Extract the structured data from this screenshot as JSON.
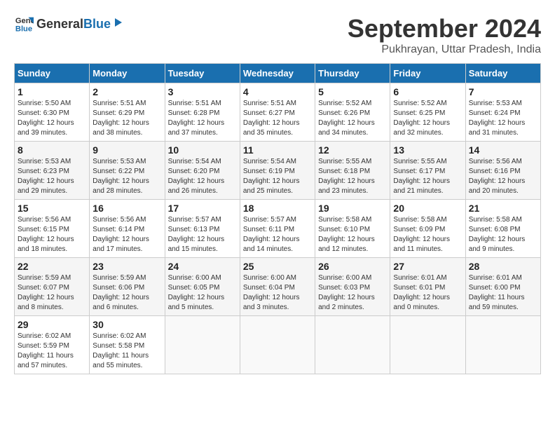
{
  "header": {
    "logo_general": "General",
    "logo_blue": "Blue",
    "month_title": "September 2024",
    "subtitle": "Pukhrayan, Uttar Pradesh, India"
  },
  "weekdays": [
    "Sunday",
    "Monday",
    "Tuesday",
    "Wednesday",
    "Thursday",
    "Friday",
    "Saturday"
  ],
  "weeks": [
    [
      {
        "day": "1",
        "sunrise": "5:50 AM",
        "sunset": "6:30 PM",
        "daylight": "12 hours and 39 minutes."
      },
      {
        "day": "2",
        "sunrise": "5:51 AM",
        "sunset": "6:29 PM",
        "daylight": "12 hours and 38 minutes."
      },
      {
        "day": "3",
        "sunrise": "5:51 AM",
        "sunset": "6:28 PM",
        "daylight": "12 hours and 37 minutes."
      },
      {
        "day": "4",
        "sunrise": "5:51 AM",
        "sunset": "6:27 PM",
        "daylight": "12 hours and 35 minutes."
      },
      {
        "day": "5",
        "sunrise": "5:52 AM",
        "sunset": "6:26 PM",
        "daylight": "12 hours and 34 minutes."
      },
      {
        "day": "6",
        "sunrise": "5:52 AM",
        "sunset": "6:25 PM",
        "daylight": "12 hours and 32 minutes."
      },
      {
        "day": "7",
        "sunrise": "5:53 AM",
        "sunset": "6:24 PM",
        "daylight": "12 hours and 31 minutes."
      }
    ],
    [
      {
        "day": "8",
        "sunrise": "5:53 AM",
        "sunset": "6:23 PM",
        "daylight": "12 hours and 29 minutes."
      },
      {
        "day": "9",
        "sunrise": "5:53 AM",
        "sunset": "6:22 PM",
        "daylight": "12 hours and 28 minutes."
      },
      {
        "day": "10",
        "sunrise": "5:54 AM",
        "sunset": "6:20 PM",
        "daylight": "12 hours and 26 minutes."
      },
      {
        "day": "11",
        "sunrise": "5:54 AM",
        "sunset": "6:19 PM",
        "daylight": "12 hours and 25 minutes."
      },
      {
        "day": "12",
        "sunrise": "5:55 AM",
        "sunset": "6:18 PM",
        "daylight": "12 hours and 23 minutes."
      },
      {
        "day": "13",
        "sunrise": "5:55 AM",
        "sunset": "6:17 PM",
        "daylight": "12 hours and 21 minutes."
      },
      {
        "day": "14",
        "sunrise": "5:56 AM",
        "sunset": "6:16 PM",
        "daylight": "12 hours and 20 minutes."
      }
    ],
    [
      {
        "day": "15",
        "sunrise": "5:56 AM",
        "sunset": "6:15 PM",
        "daylight": "12 hours and 18 minutes."
      },
      {
        "day": "16",
        "sunrise": "5:56 AM",
        "sunset": "6:14 PM",
        "daylight": "12 hours and 17 minutes."
      },
      {
        "day": "17",
        "sunrise": "5:57 AM",
        "sunset": "6:13 PM",
        "daylight": "12 hours and 15 minutes."
      },
      {
        "day": "18",
        "sunrise": "5:57 AM",
        "sunset": "6:11 PM",
        "daylight": "12 hours and 14 minutes."
      },
      {
        "day": "19",
        "sunrise": "5:58 AM",
        "sunset": "6:10 PM",
        "daylight": "12 hours and 12 minutes."
      },
      {
        "day": "20",
        "sunrise": "5:58 AM",
        "sunset": "6:09 PM",
        "daylight": "12 hours and 11 minutes."
      },
      {
        "day": "21",
        "sunrise": "5:58 AM",
        "sunset": "6:08 PM",
        "daylight": "12 hours and 9 minutes."
      }
    ],
    [
      {
        "day": "22",
        "sunrise": "5:59 AM",
        "sunset": "6:07 PM",
        "daylight": "12 hours and 8 minutes."
      },
      {
        "day": "23",
        "sunrise": "5:59 AM",
        "sunset": "6:06 PM",
        "daylight": "12 hours and 6 minutes."
      },
      {
        "day": "24",
        "sunrise": "6:00 AM",
        "sunset": "6:05 PM",
        "daylight": "12 hours and 5 minutes."
      },
      {
        "day": "25",
        "sunrise": "6:00 AM",
        "sunset": "6:04 PM",
        "daylight": "12 hours and 3 minutes."
      },
      {
        "day": "26",
        "sunrise": "6:00 AM",
        "sunset": "6:03 PM",
        "daylight": "12 hours and 2 minutes."
      },
      {
        "day": "27",
        "sunrise": "6:01 AM",
        "sunset": "6:01 PM",
        "daylight": "12 hours and 0 minutes."
      },
      {
        "day": "28",
        "sunrise": "6:01 AM",
        "sunset": "6:00 PM",
        "daylight": "11 hours and 59 minutes."
      }
    ],
    [
      {
        "day": "29",
        "sunrise": "6:02 AM",
        "sunset": "5:59 PM",
        "daylight": "11 hours and 57 minutes."
      },
      {
        "day": "30",
        "sunrise": "6:02 AM",
        "sunset": "5:58 PM",
        "daylight": "11 hours and 55 minutes."
      },
      null,
      null,
      null,
      null,
      null
    ]
  ],
  "labels": {
    "sunrise_prefix": "Sunrise: ",
    "sunset_prefix": "Sunset: ",
    "daylight_prefix": "Daylight: "
  }
}
